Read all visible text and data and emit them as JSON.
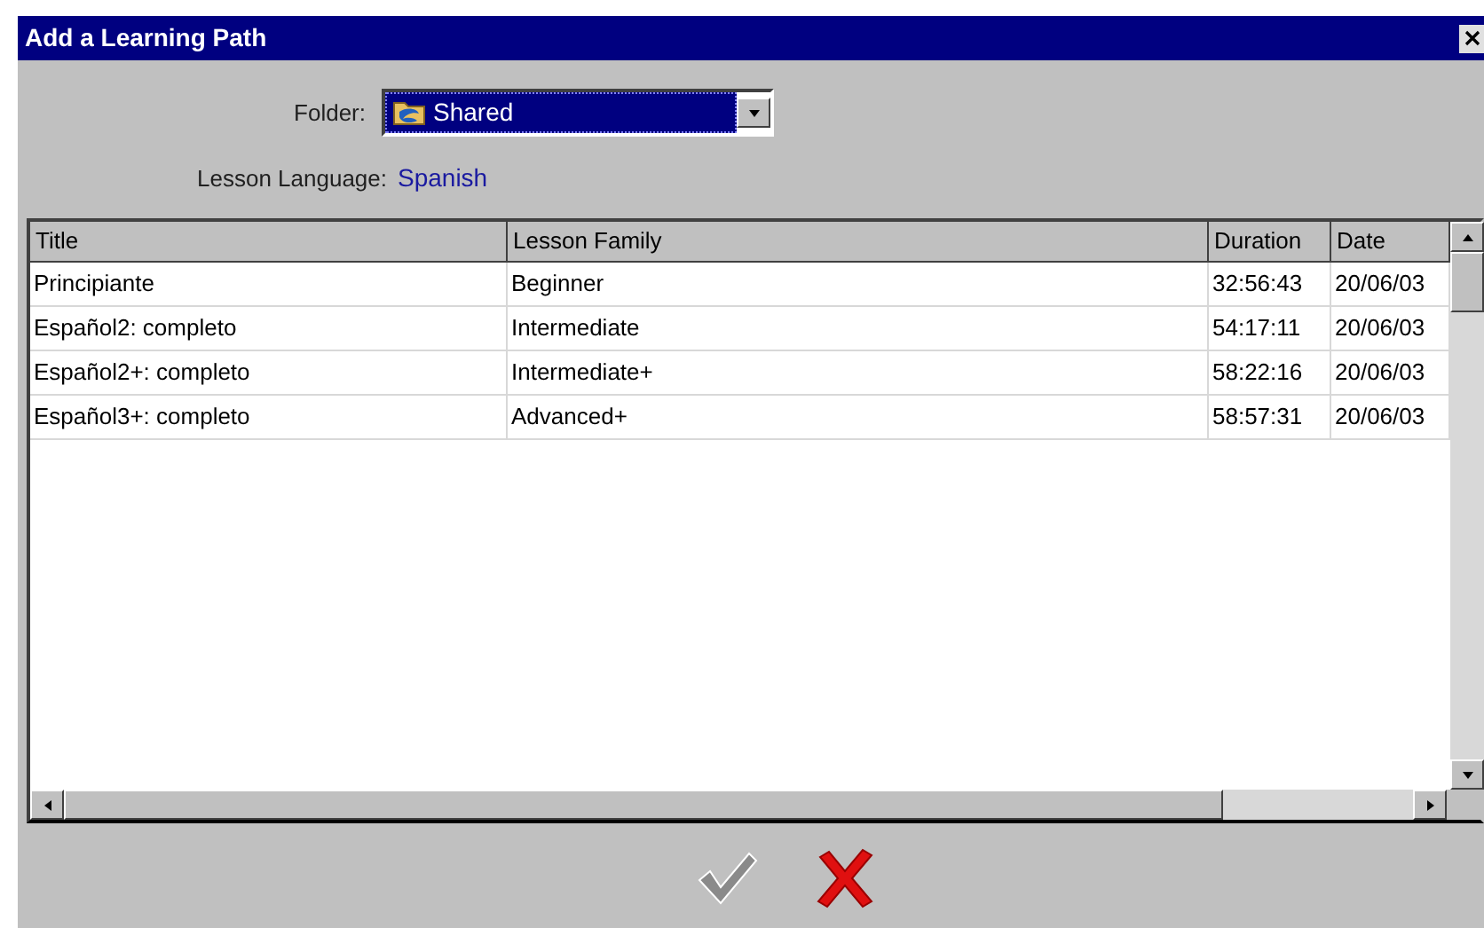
{
  "window": {
    "title": "Add a Learning Path"
  },
  "folder": {
    "label": "Folder:",
    "value": "Shared"
  },
  "language": {
    "label": "Lesson Language:",
    "value": "Spanish"
  },
  "table": {
    "columns": [
      "Title",
      "Lesson Family",
      "Duration",
      "Date"
    ],
    "rows": [
      [
        "Principiante",
        "Beginner",
        "32:56:43",
        "20/06/03"
      ],
      [
        "Español2: completo",
        "Intermediate",
        "54:17:11",
        "20/06/03"
      ],
      [
        "Español2+: completo",
        "Intermediate+",
        "58:22:16",
        "20/06/03"
      ],
      [
        "Español3+: completo",
        "Advanced+",
        "58:57:31",
        "20/06/03"
      ]
    ]
  },
  "buttons": [
    {
      "kind": "ok",
      "disabled": true
    },
    {
      "kind": "cancel",
      "disabled": false
    }
  ]
}
